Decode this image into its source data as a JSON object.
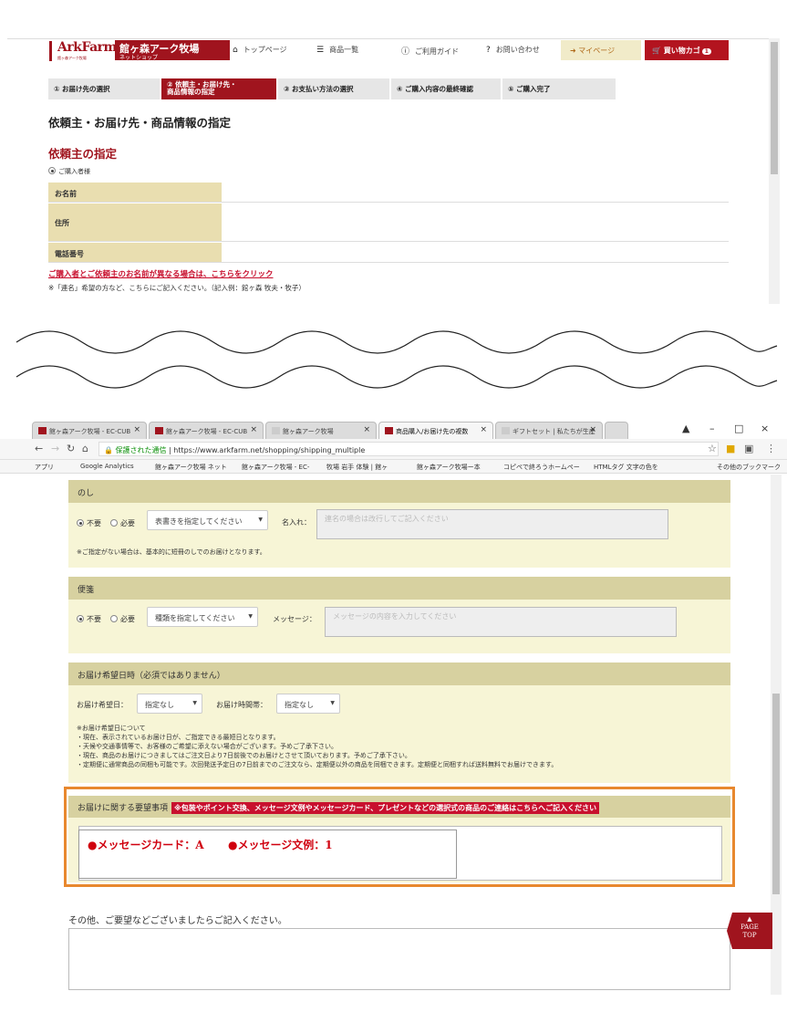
{
  "top": {
    "logo": "ArkFarm",
    "logo_sub": "館ヶ森アーク牧場",
    "brand_title": "館ヶ森アーク牧場",
    "brand_sub": "ネットショップ",
    "nav": {
      "home": "トップページ",
      "list": "商品一覧",
      "guide": "ご利用ガイド",
      "contact": "お問い合わせ",
      "mypage": "マイページ",
      "cart": "買い物カゴ",
      "cart_count": "1"
    },
    "steps": [
      "① お届け先の選択",
      "② 依頼主・お届け先・",
      "商品情報の指定",
      "③ お支払い方法の選択",
      "④ ご購入内容の最終確認",
      "⑤ ご購入完了"
    ],
    "page_title": "依頼主・お届け先・商品情報の指定",
    "section_title": "依頼主の指定",
    "radio_label": "ご購入者様",
    "rows": [
      "お名前",
      "住所",
      "電話番号"
    ],
    "link": "ご購入者とご依頼主のお名前が異なる場合は、こちらをクリック",
    "note": "※「連名」希望の方など、こちらにご記入ください。（記入例：館ヶ森 牧夫・牧子）"
  },
  "browser": {
    "tabs": [
      "館ヶ森アーク牧場 - EC-CUB",
      "館ヶ森アーク牧場 - EC-CUB",
      "館ヶ森アーク牧場",
      "商品購入/お届け先の複数",
      "ギフトセット | 私たちが生産"
    ],
    "secure": "保護された通信",
    "url": "https://www.arkfarm.net/shopping/shipping_multiple",
    "bookmarks": [
      "アプリ",
      "Google Analytics",
      "館ヶ森アーク牧場 ネット",
      "館ヶ森アーク牧場 - EC-",
      "牧場 岩手 体験 | 館ヶ",
      "館ヶ森アーク牧場ー本",
      "コピペで終ろうホームペー",
      "HTMLタグ 文字の色を",
      "その他のブックマーク"
    ]
  },
  "noshi": {
    "title": "のし",
    "opt_no": "不要",
    "opt_yes": "必要",
    "select": "表書きを指定してください",
    "name_label": "名入れ：",
    "name_placeholder": "連名の場合は改行してご記入ください",
    "note": "※ご指定がない場合は、基本的に短冊のしでのお届けとなります。"
  },
  "binsen": {
    "title": "便箋",
    "opt_no": "不要",
    "opt_yes": "必要",
    "select": "種類を指定してください",
    "msg_label": "メッセージ：",
    "msg_placeholder": "メッセージの内容を入力してください"
  },
  "delivery": {
    "title": "お届け希望日時（必須ではありません）",
    "date_label": "お届け希望日：",
    "date_value": "指定なし",
    "time_label": "お届け時間帯：",
    "time_value": "指定なし",
    "notes": [
      "※お届け希望日について",
      "・現在、表示されているお届け日が、ご指定できる最短日となります。",
      "・天候や交通事情等で、お客様のご希望に添えない場合がございます。予めご了承下さい。",
      "・現在、商品のお届けにつきましてはご注文日より7日前後でのお届けとさせて頂いております。予めご了承下さい。",
      "・定期便に通常商品の同梱も可能です。次回発送予定日の7日前までのご注文なら、定期便以外の商品を同梱できます。定期便と同梱すれば送料無料でお届けできます。"
    ]
  },
  "request": {
    "title": "お届けに関する要望事項",
    "badge": "※包装やポイント交換、メッセージ文例やメッセージカード、プレゼントなどの選択式の商品のご連絡はこちらへご記入ください",
    "msg1": "●メッセージカード：A",
    "msg2": "●メッセージ文例：1"
  },
  "other": {
    "label": "その他、ご要望などございましたらご記入ください。"
  },
  "pagetop": {
    "l1": "▲",
    "l2": "PAGE",
    "l3": "TOP"
  }
}
